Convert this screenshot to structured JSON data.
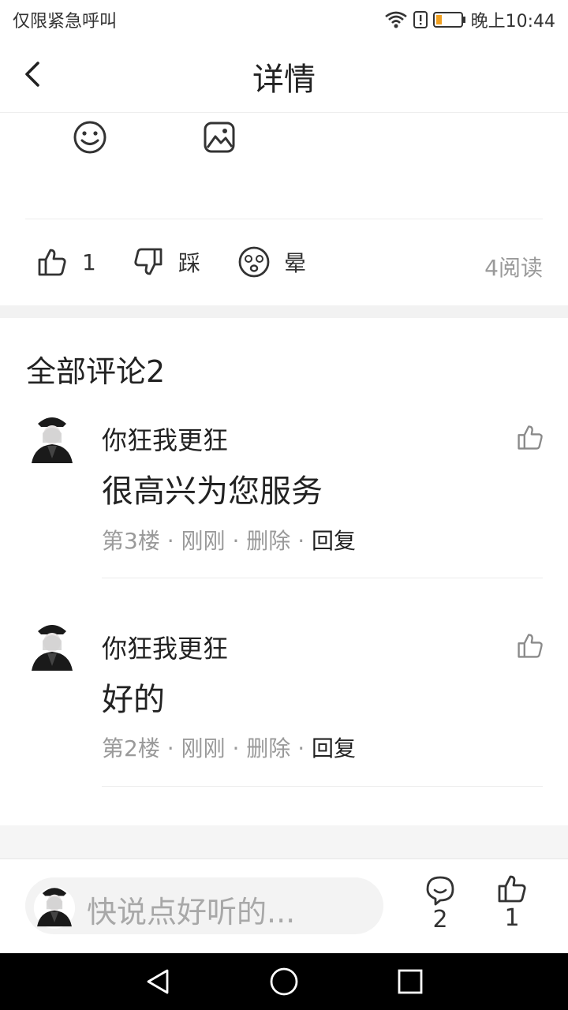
{
  "status_bar": {
    "carrier": "仅限紧急呼叫",
    "time": "晚上10:44"
  },
  "header": {
    "title": "详情"
  },
  "toolbar": {
    "emoji_icon": "smiley-icon",
    "image_icon": "image-icon"
  },
  "reactions": {
    "like_count": "1",
    "dislike_label": "踩",
    "dizzy_label": "晕",
    "reads": "4阅读"
  },
  "comments": {
    "title": "全部评论2",
    "items": [
      {
        "user": "你狂我更狂",
        "text": "很高兴为您服务",
        "floor": "第3楼",
        "time": "刚刚",
        "delete": "删除",
        "reply": "回复"
      },
      {
        "user": "你狂我更狂",
        "text": "好的",
        "floor": "第2楼",
        "time": "刚刚",
        "delete": "删除",
        "reply": "回复"
      }
    ]
  },
  "bottom_bar": {
    "placeholder": "快说点好听的...",
    "comment_count": "2",
    "like_count": "1"
  }
}
